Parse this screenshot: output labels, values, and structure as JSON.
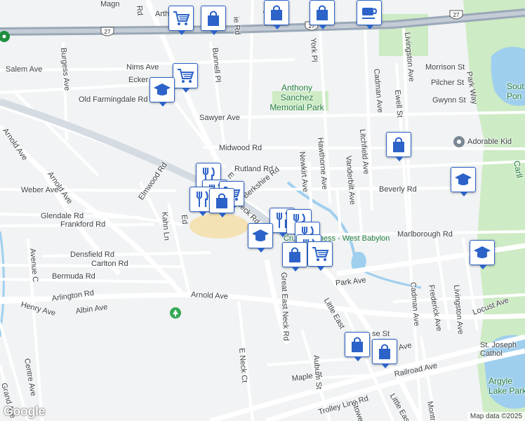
{
  "map": {
    "roads": {
      "route27": "27",
      "salem_ave": "Salem Ave",
      "nims_ave": "Nims Ave",
      "old_farmingdale_rd": "Old Farmingdale Rd",
      "burgess_ave": "Burgess Ave",
      "bunnell_pl": "Bunnell Pl",
      "sawyer_ave": "Sawyer Ave",
      "midwood_rd": "Midwood Rd",
      "rutland_rd": "Rutland Rd",
      "berkshire_rd": "Berkshire Rd",
      "great_east_neck_rd_north": "Great East Neck Rd",
      "great_east_neck_rd_south": "Great East Neck Rd",
      "arnold_ave_west": "Arnold Ave",
      "arnold_ave_diag": "Arnold Ave",
      "arnold_ave_main": "Arnold Ave",
      "weber_ave": "Weber Ave",
      "glendale_rd": "Glendale Rd",
      "frankford_rd": "Frankford Rd",
      "densfield_rd": "Densfield Rd",
      "carlton_rd": "Carlton Rd",
      "bermuda_rd": "Bermuda Rd",
      "arlington_rd": "Arlington Rd",
      "avenue_c": "Avenue C",
      "henry_ave": "Henry Ave",
      "albin_ave": "Albin Ave",
      "centre_ave": "Centre Ave",
      "grand_ave": "Grand Ave",
      "elmwood_rd": "Elmwood Rd",
      "kahn_ln": "Kahn Ln",
      "edgewood": "Ed",
      "york_pl": "York Pl",
      "newkirt_ave": "Newkirt Ave",
      "hawthorne_ave": "Hawthorne Ave",
      "vanderbilt_ave": "Vanderbilt Ave",
      "litchfield_ave": "Litchfield Ave",
      "cadman_ave_north": "Cadman Ave",
      "cadman_ave_south": "Cadman Ave",
      "ewell_st": "Ewell St",
      "livingston_ave_north": "Livingston Ave",
      "livingston_ave_south": "Livingston Ave",
      "park_way": "Park Way",
      "morrison_st": "Morrison St",
      "pilcher_st": "Pilcher St",
      "gwynn_st": "Gwynn St",
      "beverly_rd": "Beverly Rd",
      "marlborough_rd": "Marlborough Rd",
      "park_ave": "Park Ave",
      "frederick_ave": "Frederick Ave",
      "locust_ave": "Locust Ave",
      "little_east_neck_rd": "Little East",
      "little_east_neck_rd_south": "Little East",
      "se_st": "se St",
      "ave_fragment": "Ave",
      "e_neck_ct": "E Neck Ct",
      "auburn_st": "Auburn St",
      "maple_st": "Maple St",
      "railroad_ave": "Railroad Ave",
      "trolley_line_rd": "Trolley Line Rd",
      "stowe": "Stowe",
      "montrose": "Montro",
      "magnolia": "Magn",
      "arthur": "Arth",
      "top_ie_rd": "ie Rd",
      "top_e_rd": "e Rd",
      "top_rd": "Rd",
      "ecker": "Ecker",
      "neck_rd_fragment": "Neck Rd",
      "e_fragment": "E",
      "ne_fragment": "e"
    },
    "places": {
      "park": "Anthony Sanchez Memorial Park",
      "crunch": "Crunch Fitness - West Babylon",
      "adorable": "Adorable Kid",
      "st_joseph": "St. Joseph Cathol",
      "argyle": "Argyle Lake Park",
      "south_pond": "Sout Pon",
      "canal": "Carll"
    },
    "pins": [
      {
        "type": "grocery-cart"
      },
      {
        "type": "shopping-bag"
      },
      {
        "type": "shopping-bag"
      },
      {
        "type": "shopping-bag"
      },
      {
        "type": "cafe-cup"
      },
      {
        "type": "grocery-cart"
      },
      {
        "type": "school-cap"
      },
      {
        "type": "shopping-bag"
      },
      {
        "type": "school-cap"
      },
      {
        "type": "restaurant"
      },
      {
        "type": "restaurant"
      },
      {
        "type": "grocery-cart"
      },
      {
        "type": "restaurant"
      },
      {
        "type": "shopping-bag"
      },
      {
        "type": "restaurant"
      },
      {
        "type": "school-cap"
      },
      {
        "type": "restaurant"
      },
      {
        "type": "restaurant"
      },
      {
        "type": "restaurant"
      },
      {
        "type": "shopping-bag"
      },
      {
        "type": "grocery-cart"
      },
      {
        "type": "school-cap"
      },
      {
        "type": "shopping-bag"
      },
      {
        "type": "shopping-bag"
      }
    ],
    "attribution": "Map data ©2025",
    "logo": "Google",
    "colors": {
      "background": "#f1f3f4",
      "park": "#cdebc4",
      "water": "#9fcfee",
      "pin_border": "#2d63c8",
      "highway": "#9aa8b8"
    }
  }
}
